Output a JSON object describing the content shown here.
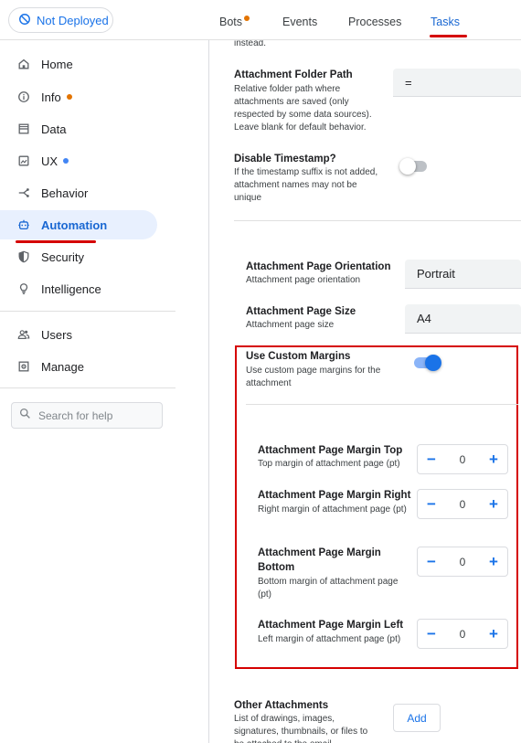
{
  "deploy": {
    "label": "Not Deployed"
  },
  "nav": {
    "items": [
      {
        "label": "Home",
        "icon": "home-icon"
      },
      {
        "label": "Info",
        "icon": "info-icon",
        "dot": "#e37400"
      },
      {
        "label": "Data",
        "icon": "data-icon"
      },
      {
        "label": "UX",
        "icon": "ux-icon",
        "dot": "#4285f4"
      },
      {
        "label": "Behavior",
        "icon": "behavior-icon"
      },
      {
        "label": "Automation",
        "icon": "automation-icon",
        "active": true
      },
      {
        "label": "Security",
        "icon": "security-icon"
      },
      {
        "label": "Intelligence",
        "icon": "intelligence-icon"
      },
      {
        "label": "Users",
        "icon": "users-icon"
      },
      {
        "label": "Manage",
        "icon": "manage-icon"
      }
    ],
    "search_placeholder": "Search for help"
  },
  "tabs": {
    "items": [
      {
        "label": "Bots",
        "dot": "#e37400"
      },
      {
        "label": "Events"
      },
      {
        "label": "Processes"
      },
      {
        "label": "Tasks",
        "active": true
      }
    ]
  },
  "settings": {
    "truncated_text": "instead.",
    "folder_path": {
      "title": "Attachment Folder Path",
      "desc": "Relative folder path where attachments are saved (only respected by some data sources). Leave blank for default behavior.",
      "value": "="
    },
    "disable_timestamp": {
      "title": "Disable Timestamp?",
      "desc": "If the timestamp suffix is not added, attachment names may not be unique",
      "on": false
    },
    "orientation": {
      "title": "Attachment Page Orientation",
      "desc": "Attachment page orientation",
      "value": "Portrait"
    },
    "page_size": {
      "title": "Attachment Page Size",
      "desc": "Attachment page size",
      "value": "A4"
    },
    "custom_margins": {
      "title": "Use Custom Margins",
      "desc": "Use custom page margins for the attachment",
      "on": true
    },
    "margins": [
      {
        "title": "Attachment Page Margin Top",
        "desc": "Top margin of attachment page (pt)",
        "value": "0"
      },
      {
        "title": "Attachment Page Margin Right",
        "desc": "Right margin of attachment page (pt)",
        "value": "0"
      },
      {
        "title": "Attachment Page Margin Bottom",
        "desc": "Bottom margin of attachment page (pt)",
        "value": "0"
      },
      {
        "title": "Attachment Page Margin Left",
        "desc": "Left margin of attachment page (pt)",
        "value": "0"
      }
    ],
    "stepper_minus": "−",
    "stepper_plus": "+",
    "other_attachments": {
      "title": "Other Attachments",
      "desc": "List of drawings, images, signatures, thumbnails, or files to be attached to the email",
      "button": "Add"
    }
  },
  "colors": {
    "accent": "#1a73e8",
    "highlight": "#d50000",
    "active_bg": "#e8f0fe"
  }
}
